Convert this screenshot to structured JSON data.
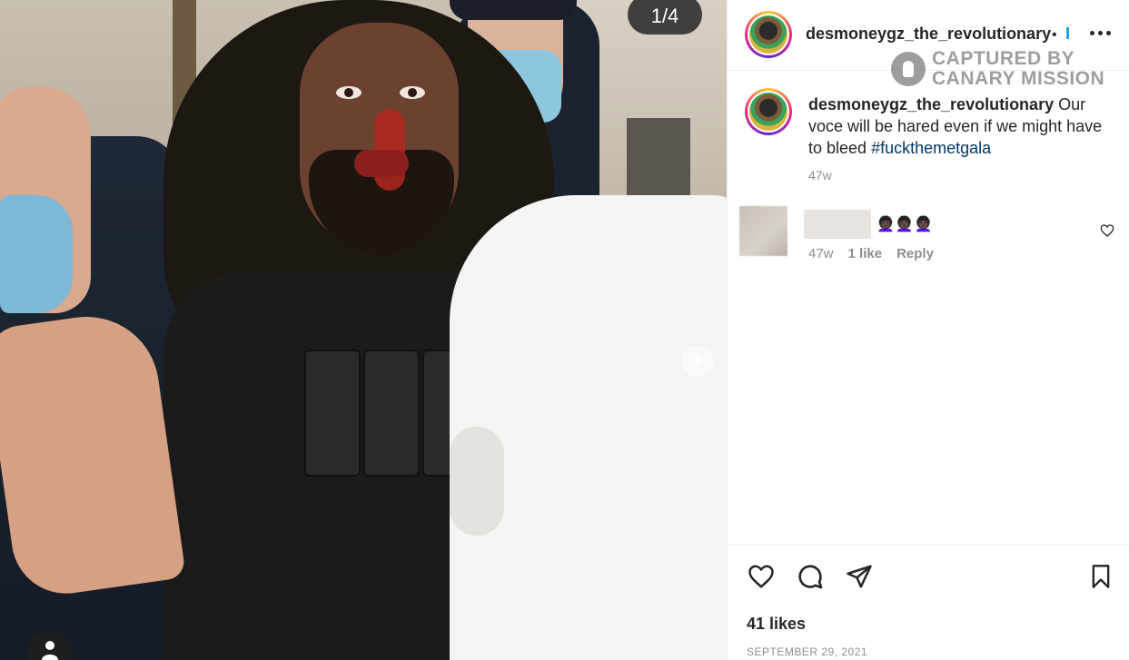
{
  "media": {
    "counter": "1/4"
  },
  "post": {
    "username": "desmoneygz_the_revolutionary",
    "separator": "•",
    "follow_label": "I"
  },
  "watermark": {
    "line1": "CAPTURED BY",
    "line2": "CANARY MISSION"
  },
  "caption": {
    "username": "desmoneygz_the_revolutionary",
    "text": " Our voce will be hared even if we might have to bleed ",
    "hashtag": "#fuckthemetgala",
    "time": "47w"
  },
  "comment": {
    "emoji": "👩🏿‍🦱👩🏿‍🦱👩🏿‍🦱",
    "time": "47w",
    "likes": "1 like",
    "reply": "Reply"
  },
  "footer": {
    "likes": "41 likes",
    "date": "SEPTEMBER 29, 2021"
  },
  "icons": {
    "heart": "heart-icon",
    "comment": "comment-icon",
    "share": "share-icon",
    "save": "bookmark-icon",
    "more": "more-icon",
    "next": "chevron-right-icon",
    "tag": "user-tag-icon"
  }
}
